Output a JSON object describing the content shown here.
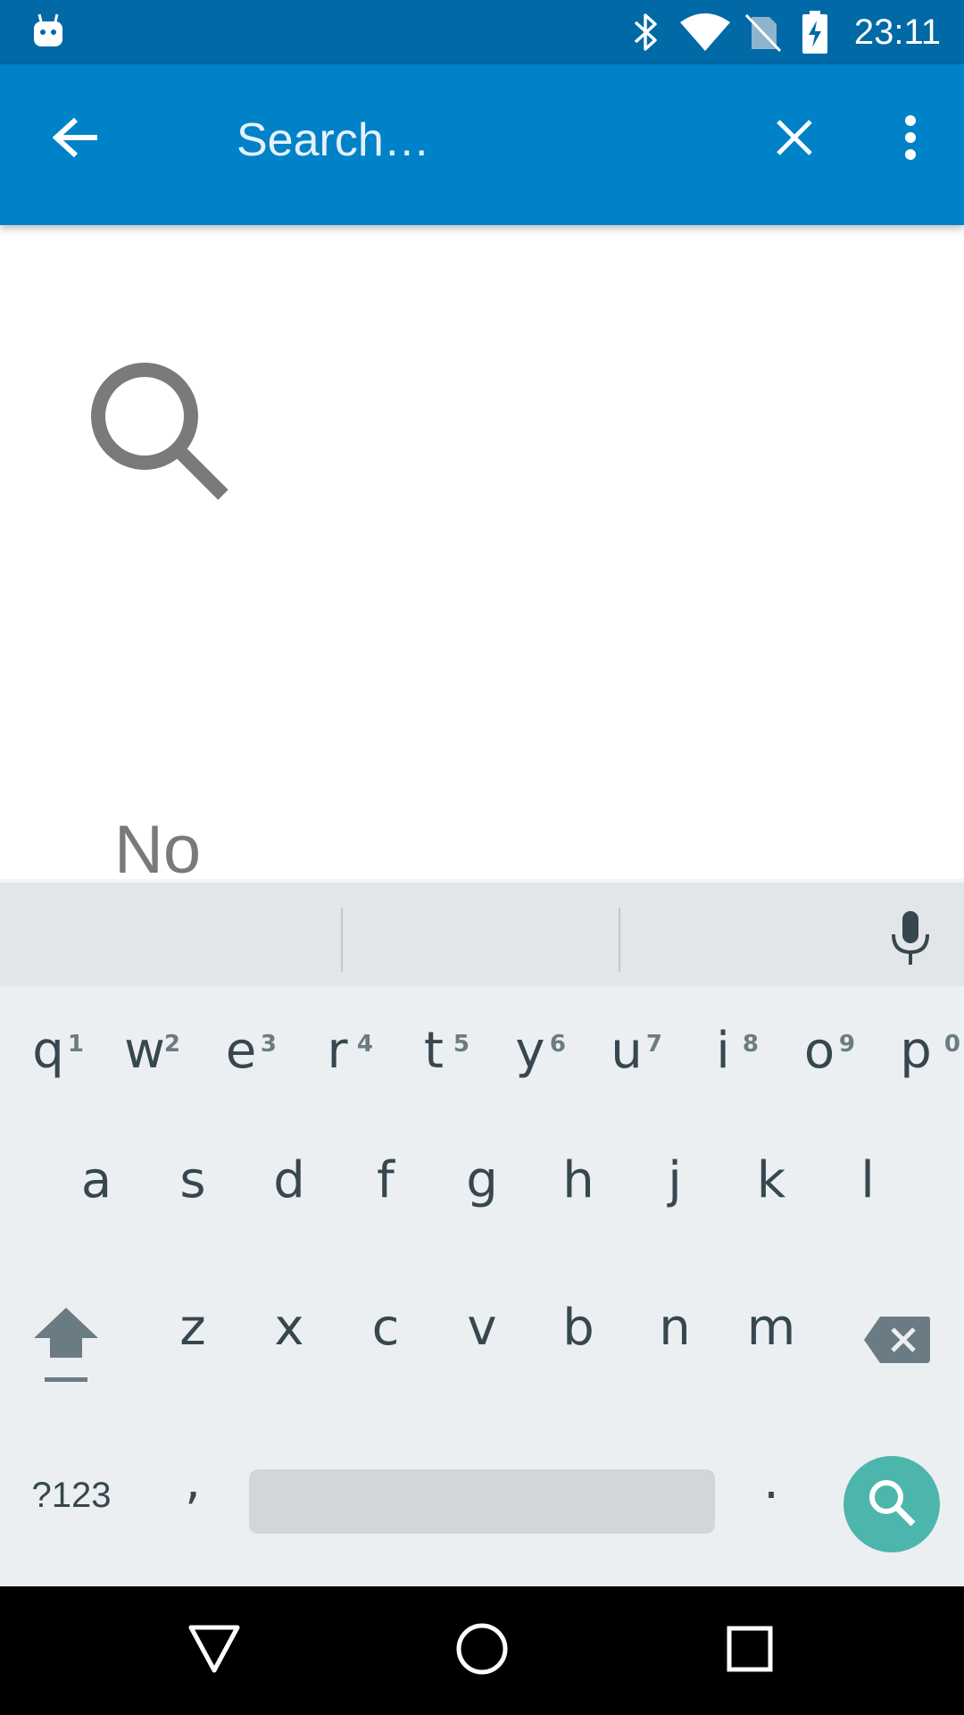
{
  "status_bar": {
    "time": "23:11",
    "icons": [
      "android-notification-icon",
      "bluetooth-icon",
      "wifi-icon",
      "no-sim-icon",
      "battery-charging-icon"
    ]
  },
  "app_bar": {
    "search_placeholder": "Search…",
    "search_value": "",
    "icons": [
      "back-arrow-icon",
      "close-icon",
      "overflow-menu-icon"
    ],
    "color": "#0082c8"
  },
  "empty_state": {
    "icon": "search-icon",
    "text": "No"
  },
  "keyboard": {
    "row1": [
      {
        "letter": "q",
        "hint": "1"
      },
      {
        "letter": "w",
        "hint": "2"
      },
      {
        "letter": "e",
        "hint": "3"
      },
      {
        "letter": "r",
        "hint": "4"
      },
      {
        "letter": "t",
        "hint": "5"
      },
      {
        "letter": "y",
        "hint": "6"
      },
      {
        "letter": "u",
        "hint": "7"
      },
      {
        "letter": "i",
        "hint": "8"
      },
      {
        "letter": "o",
        "hint": "9"
      },
      {
        "letter": "p",
        "hint": "0"
      }
    ],
    "row2": [
      "a",
      "s",
      "d",
      "f",
      "g",
      "h",
      "j",
      "k",
      "l"
    ],
    "row3": [
      "z",
      "x",
      "c",
      "v",
      "b",
      "n",
      "m"
    ],
    "symbols_label": "?123",
    "comma_label": ",",
    "period_label": ".",
    "search_key_color": "#4db6ac"
  },
  "nav_bar": {
    "icons": [
      "back-triangle-icon",
      "home-circle-icon",
      "recents-square-icon"
    ]
  }
}
